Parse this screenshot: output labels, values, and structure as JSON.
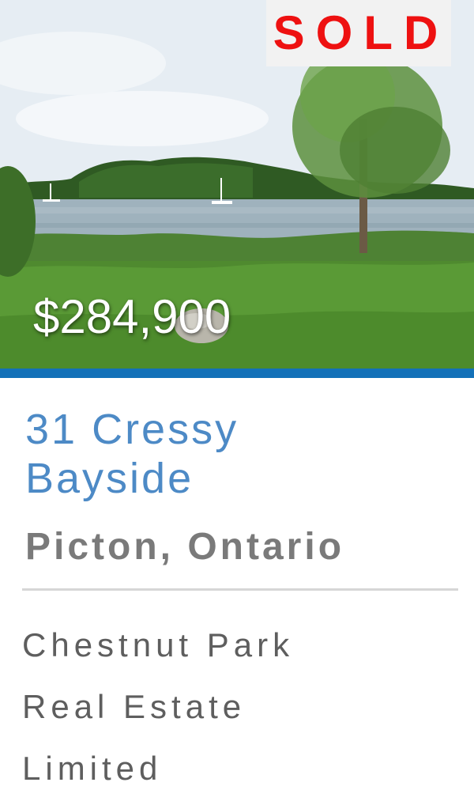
{
  "listing": {
    "status_badge": "SOLD",
    "price": "$284,900",
    "address": "31 Cressy Bayside",
    "address_lines": [
      "31 Cressy",
      "Bayside"
    ],
    "city": "Picton, Ontario",
    "brokerage_lines": [
      "Chestnut Park",
      "Real Estate",
      "Limited"
    ]
  },
  "colors": {
    "accent": "#1371b8",
    "address_text": "#4d8ac6",
    "sold_text": "#ee1111",
    "city_text": "#7a7a7a",
    "brokerage_text": "#5e5e5e"
  }
}
